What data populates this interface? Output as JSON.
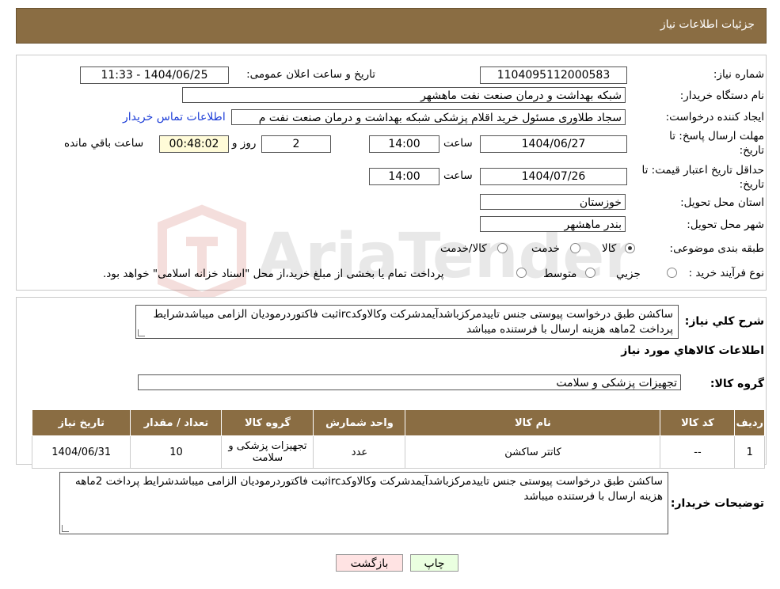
{
  "header": {
    "title": "جزئیات اطلاعات نیاز"
  },
  "form": {
    "need_number_label": "شماره نیاز:",
    "need_number": "1104095112000583",
    "announce_label": "تاریخ و ساعت اعلان عمومی:",
    "announce_value": "1404/06/25 - 11:33",
    "buyer_label": "نام دستگاه خریدار:",
    "buyer_value": "شبکه بهداشت و درمان صنعت نفت ماهشهر",
    "creator_label": "ایجاد کننده درخواست:",
    "creator_value": "سجاد طلاوری مسئول خرید اقلام پزشکی شبکه بهداشت و درمان صنعت نفت م",
    "contact_link": "اطلاعات تماس خریدار",
    "deadline_label_1": "مهلت ارسال پاسخ: تا",
    "deadline_label_2": "تاریخ:",
    "deadline_date": "1404/06/27",
    "time_label": "ساعت",
    "deadline_time": "14:00",
    "days_value": "2",
    "days_label": "روز و",
    "remaining_value": "00:48:02",
    "remaining_label": "ساعت باقي مانده",
    "validity_label_1": "حداقل تاریخ اعتبار قیمت: تا",
    "validity_label_2": "تاریخ:",
    "validity_date": "1404/07/26",
    "validity_time": "14:00",
    "province_label": "استان محل تحویل:",
    "province_value": "خوزستان",
    "city_label": "شهر محل تحویل:",
    "city_value": "بندر ماهشهر",
    "category_label": "طبقه بندی موضوعی:",
    "category_options": [
      "کالا",
      "خدمت",
      "کالا/خدمت"
    ],
    "purchase_label": "نوع فرآیند خرید :",
    "purchase_options": [
      "جزیي",
      "متوسط"
    ],
    "purchase_note": "پرداخت تمام یا بخشی از مبلغ خرید،از محل \"اسناد خزانه اسلامی\" خواهد بود."
  },
  "summary": {
    "label": "شرح کلي نیاز:",
    "text": "ساکشن طبق درخواست پیوستی جنس تاییدمرکزباشدآیمدشرکت وکالاوکدircثبت فاکتوردرمودیان الزامی میباشدشرایط پرداخت 2ماهه هزینه ارسال با فرستنده میباشد",
    "items_title": "اطلاعات کالاهاي مورد نیاز",
    "group_label": "گروه کالا:",
    "group_value": "تجهیزات پزشکی و سلامت"
  },
  "table": {
    "headers": [
      "ردیف",
      "کد کالا",
      "نام کالا",
      "واحد شمارش",
      "گروه کالا",
      "تعداد / مقدار",
      "تاریخ نیاز"
    ],
    "rows": [
      [
        "1",
        "--",
        "کاتتر ساکشن",
        "عدد",
        "تجهیزات پزشکی و سلامت",
        "10",
        "1404/06/31"
      ]
    ]
  },
  "buyer_notes": {
    "label": "توضیحات خریدار:",
    "text": "ساکشن طبق درخواست پیوستی جنس تاییدمرکزباشدآیمدشرکت وکالاوکدircثبت فاکتوردرمودیان الزامی میباشدشرایط پرداخت 2ماهه هزینه ارسال با فرستنده میباشد"
  },
  "buttons": {
    "print": "چاپ",
    "back": "بازگشت"
  },
  "watermark": {
    "text": "AriaTender.neT"
  },
  "colors": {
    "header_bg": "#8a6d43",
    "link": "#1e3fd8",
    "print_bg": "#eaffe0",
    "back_bg": "#ffe3e3"
  }
}
